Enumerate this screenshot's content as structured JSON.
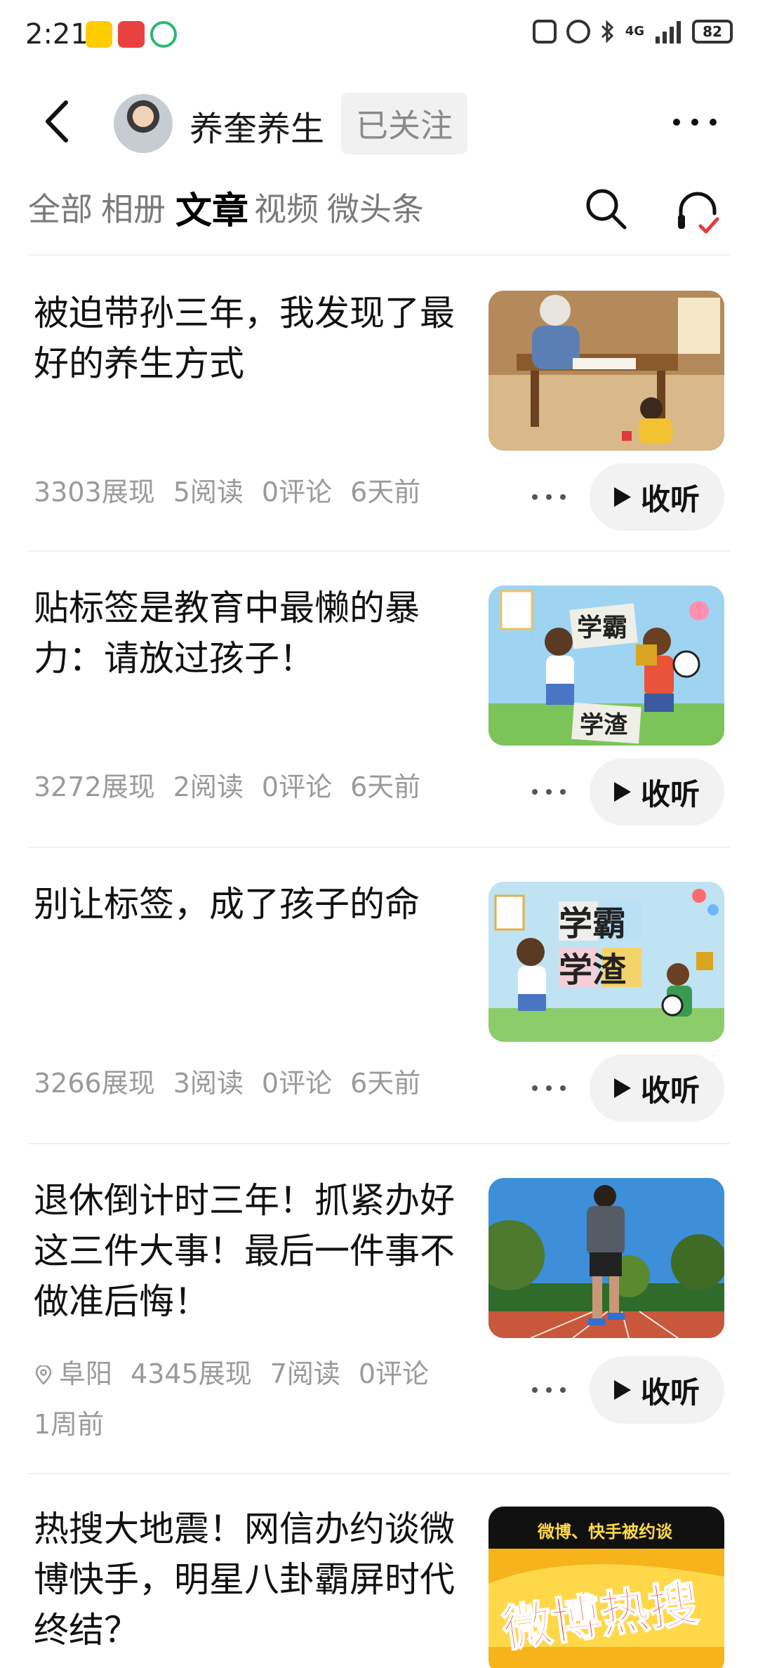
{
  "status_bar": {
    "time": "2:21",
    "network": "4G",
    "battery": "82",
    "icons": [
      "weibo-icon",
      "xhs-icon",
      "green-app-icon",
      "nfc-icon",
      "alarm-icon",
      "bluetooth-icon",
      "signal-icon",
      "battery-icon"
    ]
  },
  "header": {
    "author_name": "养奎养生",
    "follow_label": "已关注"
  },
  "tabs": [
    {
      "label": "全部"
    },
    {
      "label": "相册"
    },
    {
      "label": "文章"
    },
    {
      "label": "视频"
    },
    {
      "label": "微头条"
    }
  ],
  "active_tab": "文章",
  "articles": [
    {
      "title": "被迫带孙三年，我发现了最好的养生方式",
      "location": "",
      "impressions": "3303展现",
      "reads": "5阅读",
      "comments": "0评论",
      "time": "6天前",
      "listen_label": "收听",
      "thumb_text_1": "",
      "thumb_text_2": ""
    },
    {
      "title": "贴标签是教育中最懒的暴力：请放过孩子！",
      "location": "",
      "impressions": "3272展现",
      "reads": "2阅读",
      "comments": "0评论",
      "time": "6天前",
      "listen_label": "收听",
      "thumb_text_1": "学霸",
      "thumb_text_2": "学渣"
    },
    {
      "title": "别让标签，成了孩子的命",
      "location": "",
      "impressions": "3266展现",
      "reads": "3阅读",
      "comments": "0评论",
      "time": "6天前",
      "listen_label": "收听",
      "thumb_text_1": "学霸",
      "thumb_text_2": "学渣"
    },
    {
      "title": "退休倒计时三年！抓紧办好这三件大事！最后一件事不做准后悔！",
      "location": "阜阳",
      "impressions": "4345展现",
      "reads": "7阅读",
      "comments": "0评论",
      "time": "1周前",
      "listen_label": "收听",
      "thumb_text_1": "",
      "thumb_text_2": ""
    },
    {
      "title": "热搜大地震！网信办约谈微博快手，明星八卦霸屏时代终结？",
      "location": "",
      "impressions": "",
      "reads": "",
      "comments": "",
      "time": "",
      "listen_label": "",
      "thumb_text_1": "微博、快手被约谈",
      "thumb_text_2": "微博热搜"
    }
  ],
  "colors": {
    "accent_red": "#e8383d",
    "meta_gray": "#9a9a9a",
    "tab_gray": "#7a7a7a"
  }
}
